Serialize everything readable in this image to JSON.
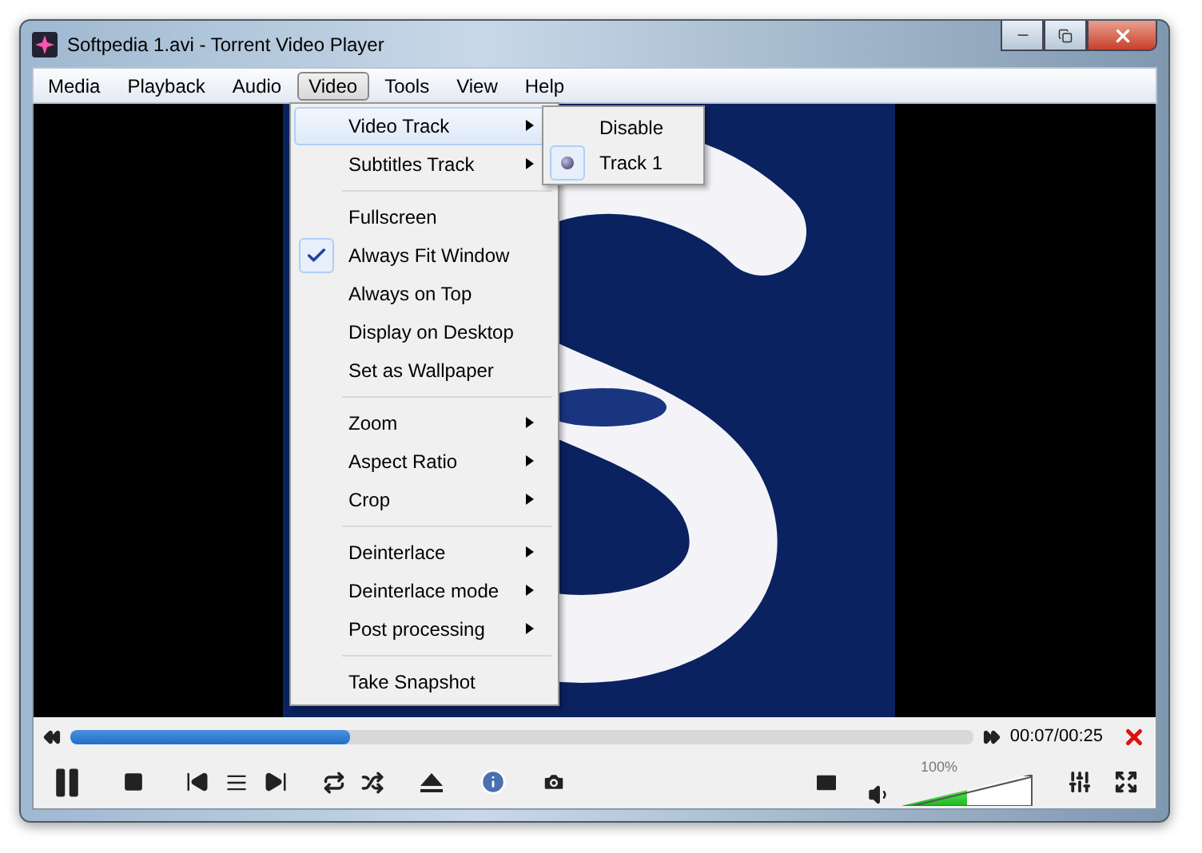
{
  "window": {
    "title": "Softpedia 1.avi - Torrent Video Player"
  },
  "menu_bar": [
    {
      "label": "Media",
      "selected": false
    },
    {
      "label": "Playback",
      "selected": false
    },
    {
      "label": "Audio",
      "selected": false
    },
    {
      "label": "Video",
      "selected": true
    },
    {
      "label": "Tools",
      "selected": false
    },
    {
      "label": "View",
      "selected": false
    },
    {
      "label": "Help",
      "selected": false
    }
  ],
  "video_menu": [
    {
      "kind": "item",
      "label": "Video Track",
      "submenu": true,
      "checked": false,
      "highlighted": true
    },
    {
      "kind": "item",
      "label": "Subtitles Track",
      "submenu": true,
      "checked": false,
      "highlighted": false
    },
    {
      "kind": "separator"
    },
    {
      "kind": "item",
      "label": "Fullscreen",
      "submenu": false,
      "checked": false,
      "highlighted": false
    },
    {
      "kind": "item",
      "label": "Always Fit Window",
      "submenu": false,
      "checked": true,
      "highlighted": false
    },
    {
      "kind": "item",
      "label": "Always on Top",
      "submenu": false,
      "checked": false,
      "highlighted": false
    },
    {
      "kind": "item",
      "label": "Display on Desktop",
      "submenu": false,
      "checked": false,
      "highlighted": false
    },
    {
      "kind": "item",
      "label": "Set as Wallpaper",
      "submenu": false,
      "checked": false,
      "highlighted": false
    },
    {
      "kind": "separator"
    },
    {
      "kind": "item",
      "label": "Zoom",
      "submenu": true,
      "checked": false,
      "highlighted": false
    },
    {
      "kind": "item",
      "label": "Aspect Ratio",
      "submenu": true,
      "checked": false,
      "highlighted": false
    },
    {
      "kind": "item",
      "label": "Crop",
      "submenu": true,
      "checked": false,
      "highlighted": false
    },
    {
      "kind": "separator"
    },
    {
      "kind": "item",
      "label": "Deinterlace",
      "submenu": true,
      "checked": false,
      "highlighted": false
    },
    {
      "kind": "item",
      "label": "Deinterlace mode",
      "submenu": true,
      "checked": false,
      "highlighted": false
    },
    {
      "kind": "item",
      "label": "Post processing",
      "submenu": true,
      "checked": false,
      "highlighted": false
    },
    {
      "kind": "separator"
    },
    {
      "kind": "item",
      "label": "Take Snapshot",
      "submenu": false,
      "checked": false,
      "highlighted": false
    }
  ],
  "video_track_submenu": [
    {
      "label": "Disable",
      "selected": false
    },
    {
      "label": "Track 1",
      "selected": true
    }
  ],
  "seek": {
    "level": 0.31,
    "time": "00:07/00:25"
  },
  "volume": {
    "level": 0.5,
    "reading": "100%"
  }
}
